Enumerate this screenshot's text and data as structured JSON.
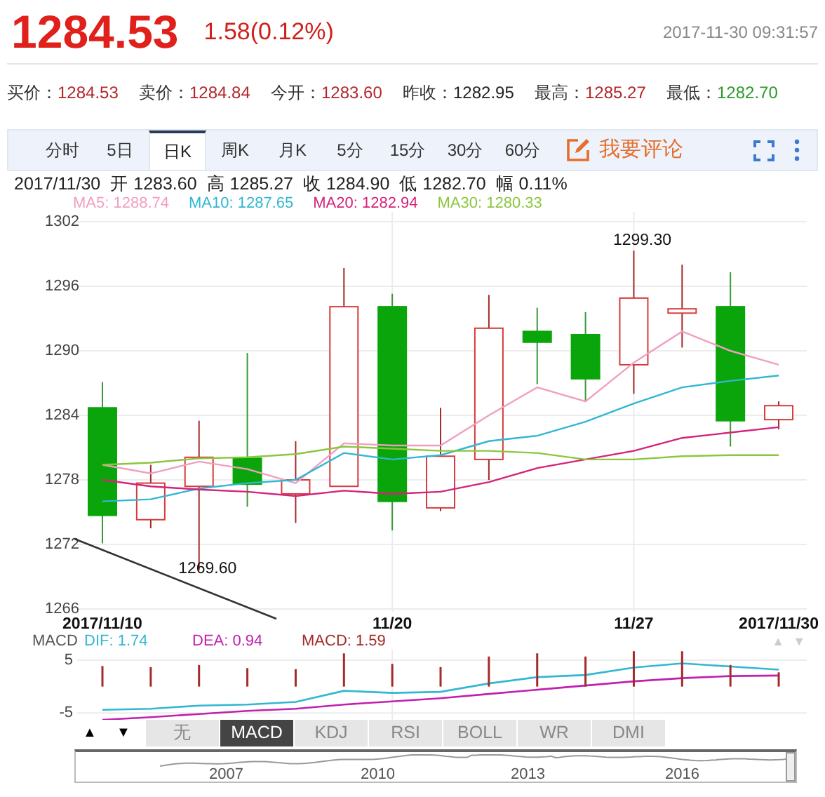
{
  "quote": {
    "price": "1284.53",
    "change": "1.58(0.12%)",
    "timestamp": "2017-11-30 09:31:57"
  },
  "stats": [
    {
      "label": "买价：",
      "value": "1284.53",
      "color": "#b3262b"
    },
    {
      "label": "卖价：",
      "value": "1284.84",
      "color": "#b3262b"
    },
    {
      "label": "今开：",
      "value": "1283.60",
      "color": "#b3262b"
    },
    {
      "label": "昨收：",
      "value": "1282.95",
      "color": "#222222"
    },
    {
      "label": "最高：",
      "value": "1285.27",
      "color": "#b3262b"
    },
    {
      "label": "最低：",
      "value": "1282.70",
      "color": "#2a9a2a"
    }
  ],
  "period_tabs": [
    {
      "label": "分时",
      "selected": false
    },
    {
      "label": "5日",
      "selected": false
    },
    {
      "label": "日K",
      "selected": true
    },
    {
      "label": "周K",
      "selected": false
    },
    {
      "label": "月K",
      "selected": false
    },
    {
      "label": "5分",
      "selected": false
    },
    {
      "label": "15分",
      "selected": false
    },
    {
      "label": "30分",
      "selected": false
    },
    {
      "label": "60分",
      "selected": false
    }
  ],
  "comment_button": {
    "label": "我要评论"
  },
  "ohlc_summary": {
    "date": "2017/11/30",
    "items": [
      {
        "label": "开",
        "value": "1283.60"
      },
      {
        "label": "高",
        "value": "1285.27"
      },
      {
        "label": "收",
        "value": "1284.90"
      },
      {
        "label": "低",
        "value": "1282.70"
      },
      {
        "label": "幅",
        "value": "0.11%"
      }
    ]
  },
  "ma_legend": [
    {
      "value": ": 1288.74"
    },
    {
      "value": ": 1287.65"
    },
    {
      "value": ": 1282.94"
    },
    {
      "value": ": 1280.33"
    }
  ],
  "price_chart": {
    "chart_data": {
      "type": "line",
      "categories": [
        "2017/11/10",
        null,
        null,
        null,
        null,
        null,
        "11/20",
        null,
        null,
        null,
        null,
        "11/27",
        null,
        null,
        "2017/11/30"
      ],
      "ylim": [
        1266,
        1302
      ],
      "yticks": [
        1302,
        1296,
        1290,
        1284,
        1278,
        1272,
        1266
      ],
      "series": [
        {
          "name": "MA5",
          "color": "#f19ec2",
          "values": [
            1279.4,
            1278.6,
            1279.7,
            1279.0,
            1277.7,
            1281.4,
            1281.2,
            1281.2,
            1284.0,
            1286.6,
            1285.3,
            1288.9,
            1291.8,
            1290.0,
            1288.7
          ]
        },
        {
          "name": "MA10",
          "color": "#31b7d3",
          "values": [
            1276.0,
            1276.2,
            1277.2,
            1277.7,
            1278.0,
            1280.5,
            1279.9,
            1280.3,
            1281.6,
            1282.1,
            1283.4,
            1285.1,
            1286.6,
            1287.2,
            1287.7
          ]
        },
        {
          "name": "MA20",
          "color": "#d4237a",
          "values": [
            1278.0,
            1277.4,
            1277.1,
            1276.9,
            1276.5,
            1277.0,
            1276.7,
            1276.9,
            1277.8,
            1279.1,
            1279.9,
            1280.7,
            1281.9,
            1282.4,
            1282.9
          ]
        },
        {
          "name": "MA30",
          "color": "#8cc63f",
          "values": [
            1279.4,
            1279.6,
            1280.0,
            1280.1,
            1280.4,
            1281.1,
            1280.9,
            1280.7,
            1280.7,
            1280.5,
            1279.9,
            1279.9,
            1280.2,
            1280.3,
            1280.3
          ]
        },
        {
          "type": "candlestick",
          "ohlc": [
            [
              1284.7,
              1287.1,
              1272.1,
              1274.7
            ],
            [
              1274.3,
              1279.4,
              1273.5,
              1277.7
            ],
            [
              1277.4,
              1283.5,
              1269.6,
              1280.1
            ],
            [
              1280.0,
              1289.8,
              1275.5,
              1277.6
            ],
            [
              1276.7,
              1281.6,
              1274.0,
              1278.0
            ],
            [
              1277.4,
              1297.7,
              1277.4,
              1294.1
            ],
            [
              1294.1,
              1295.3,
              1273.3,
              1276.0
            ],
            [
              1275.4,
              1284.7,
              1275.1,
              1280.2
            ],
            [
              1279.9,
              1295.2,
              1278.0,
              1292.1
            ],
            [
              1291.8,
              1294.0,
              1286.9,
              1290.8
            ],
            [
              1291.5,
              1293.6,
              1285.3,
              1287.4
            ],
            [
              1288.7,
              1299.3,
              1286.0,
              1294.9
            ],
            [
              1293.5,
              1298.0,
              1290.3,
              1293.9
            ],
            [
              1294.1,
              1297.3,
              1281.1,
              1283.5
            ],
            [
              1283.6,
              1285.3,
              1282.7,
              1284.9
            ]
          ]
        }
      ],
      "annotations": [
        "1269.60",
        "1299.30"
      ],
      "grid": true
    }
  },
  "macd_legend": {
    "title": "MACD",
    "items": [
      {
        "value": ": 1.74"
      },
      {
        "value": ": 0.94"
      },
      {
        "value": ": 1.59"
      }
    ],
    "arrows": [
      "▲",
      "▼"
    ]
  },
  "macd_chart": {
    "chart_data": {
      "type": "bar",
      "ylim": [
        -6.3,
        7
      ],
      "yticks": [
        5,
        -5
      ],
      "grid": true,
      "series": [
        {
          "name": "DIF",
          "type": "line",
          "color": "#31b7d3",
          "values": [
            -4.4,
            -4.2,
            -3.6,
            -3.4,
            -2.9,
            -0.8,
            -1.2,
            -1.0,
            0.6,
            1.8,
            2.2,
            3.6,
            4.4,
            3.8,
            3.2
          ]
        },
        {
          "name": "DEA",
          "type": "line",
          "color": "#c020b0",
          "values": [
            -6.3,
            -5.8,
            -5.2,
            -4.6,
            -4.2,
            -3.4,
            -2.8,
            -2.2,
            -1.4,
            -0.6,
            0.2,
            1.0,
            1.6,
            2.0,
            2.1
          ]
        },
        {
          "name": "MACD",
          "color": "#a52a2a",
          "values": [
            3.9,
            3.7,
            4.1,
            3.5,
            3.3,
            6.3,
            4.3,
            3.7,
            5.7,
            6.3,
            5.7,
            6.7,
            6.7,
            4.1,
            2.7
          ]
        }
      ]
    }
  },
  "indicator_controls": {
    "up": "▲",
    "down": "▼"
  },
  "indicator_tabs": [
    {
      "label": "无",
      "selected": false
    },
    {
      "label": "MACD",
      "selected": true
    },
    {
      "label": "KDJ",
      "selected": false
    },
    {
      "label": "RSI",
      "selected": false
    },
    {
      "label": "BOLL",
      "selected": false
    },
    {
      "label": "WR",
      "selected": false
    },
    {
      "label": "DMI",
      "selected": false
    }
  ],
  "navigator": {
    "years": [
      "2007",
      "2010",
      "2013",
      "2016"
    ]
  }
}
